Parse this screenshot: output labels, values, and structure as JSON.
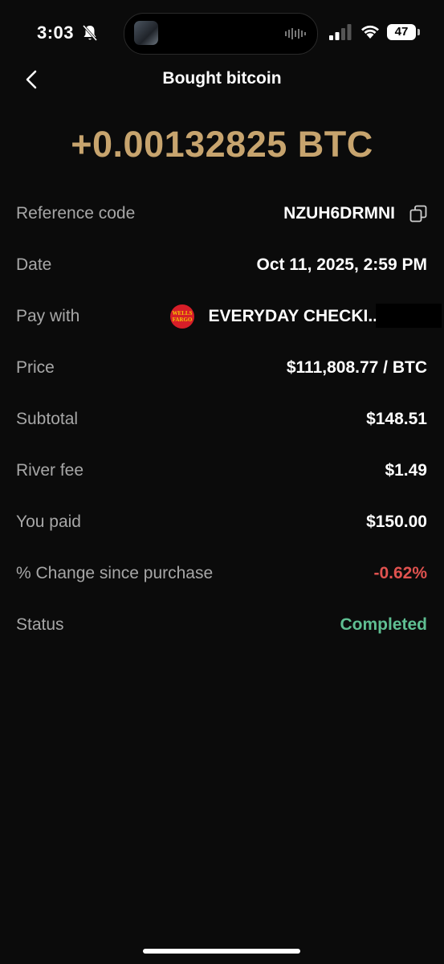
{
  "status_bar": {
    "time": "3:03",
    "battery": "47"
  },
  "header": {
    "title": "Bought bitcoin"
  },
  "amount": "+0.00132825 BTC",
  "details": {
    "reference": {
      "label": "Reference code",
      "value": "NZUH6DRMNI"
    },
    "date": {
      "label": "Date",
      "value": "Oct 11, 2025, 2:59 PM"
    },
    "pay_with": {
      "label": "Pay with",
      "value": "EVERYDAY CHECKI..",
      "bank_logo_text": [
        "WELLS",
        "FARGO"
      ]
    },
    "price": {
      "label": "Price",
      "value": "$111,808.77 / BTC"
    },
    "subtotal": {
      "label": "Subtotal",
      "value": "$148.51"
    },
    "river_fee": {
      "label": "River fee",
      "value": "$1.49"
    },
    "you_paid": {
      "label": "You paid",
      "value": "$150.00"
    },
    "change": {
      "label": "% Change since purchase",
      "value": "-0.62%"
    },
    "status": {
      "label": "Status",
      "value": "Completed"
    }
  },
  "colors": {
    "amount": "#c7a46e",
    "negative": "#e0524f",
    "completed": "#5fbf92",
    "background": "#0b0b0b"
  },
  "icons": {
    "back": "chevron-left-icon",
    "copy": "copy-icon",
    "bank": "wells-fargo-logo"
  }
}
